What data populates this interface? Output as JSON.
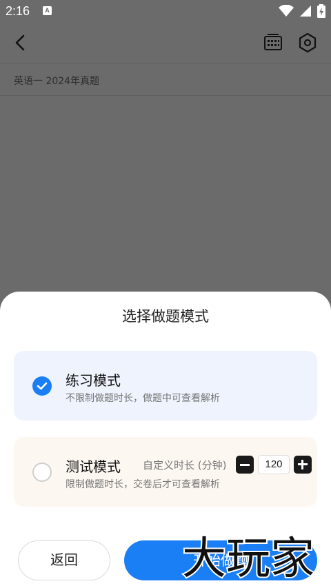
{
  "status_bar": {
    "time": "2:16",
    "badge": "A"
  },
  "header": {
    "subtitle": "英语一 2024年真题"
  },
  "sheet": {
    "title": "选择做题模式",
    "practice_mode": {
      "title": "练习模式",
      "description": "不限制做题时长，做题中可查看解析",
      "selected": true
    },
    "test_mode": {
      "title": "测试模式",
      "description": "限制做题时长，交卷后才可查看解析",
      "duration_label": "自定义时长 (分钟)",
      "duration_value": "120",
      "selected": false
    },
    "back_button": "返回",
    "start_button": "开始做题"
  },
  "watermark": {
    "text": "大玩家"
  },
  "colors": {
    "accent": "#1a7ef5",
    "overlay": "#6b6b6b"
  }
}
